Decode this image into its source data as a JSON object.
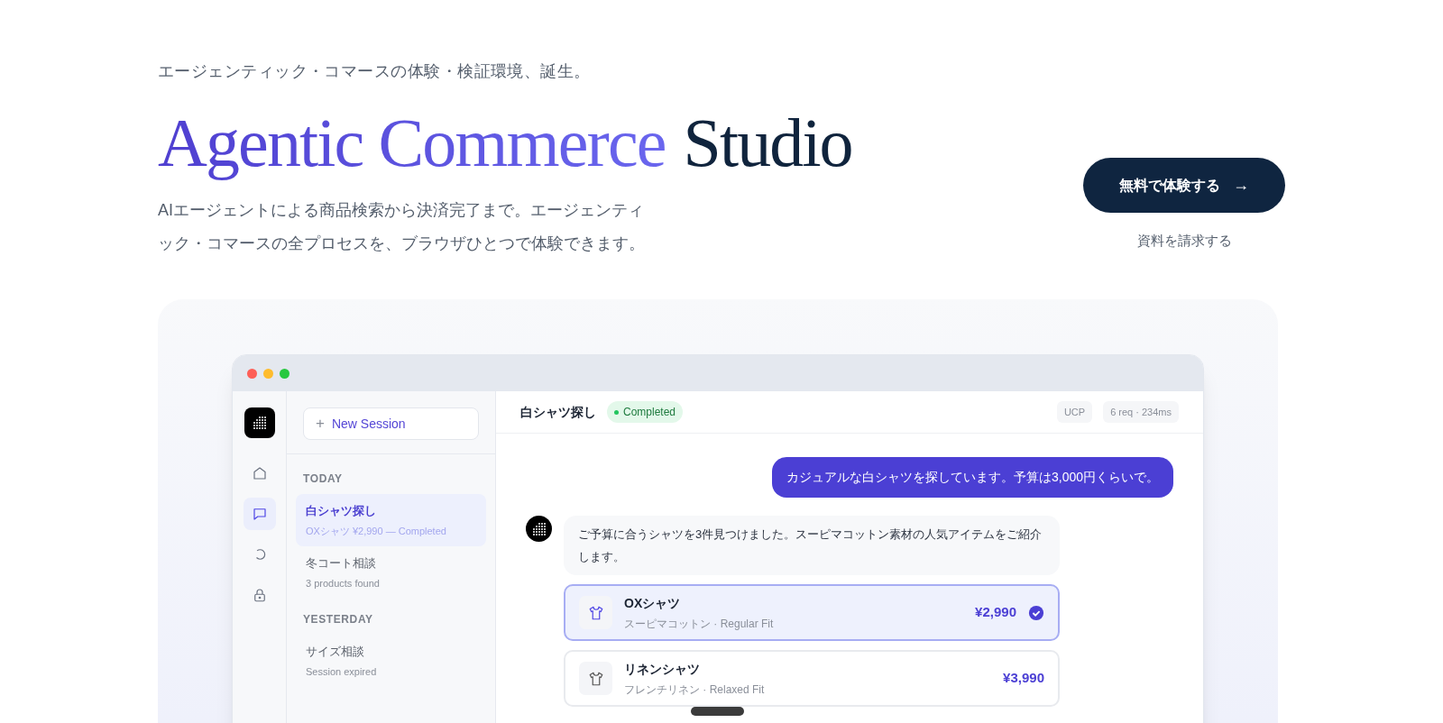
{
  "hero": {
    "tagline": "エージェンティック・コマースの体験・検証環境、誕生。",
    "title": [
      {
        "text": "Agentic Commerce",
        "accent": true
      },
      {
        "text": "Studio",
        "accent": false
      }
    ],
    "description": "AIエージェントによる商品検索から決済完了まで。エージェンティック・コマースの全プロセスを、ブラウザひとつで体験できます。",
    "primary_button": {
      "label": "無料で体験する",
      "arrow": "→"
    },
    "secondary_link": "資料を請求する"
  },
  "app": {
    "rail": [
      {
        "kind": "home",
        "selected": false
      },
      {
        "kind": "chat",
        "selected": true
      },
      {
        "kind": "refresh",
        "selected": false
      },
      {
        "kind": "lock",
        "selected": false
      }
    ],
    "new_session": {
      "icon": "+",
      "label": "New Session"
    },
    "session_groups": [
      {
        "label": "TODAY",
        "items": [
          {
            "title": "白シャツ探し",
            "subtitle": "OXシャツ ¥2,990 — Completed",
            "selected": true
          },
          {
            "title": "冬コート相談",
            "subtitle": "3 products found",
            "selected": false
          }
        ]
      },
      {
        "label": "YESTERDAY",
        "items": [
          {
            "title": "サイズ相談",
            "subtitle": "Session expired",
            "selected": false
          }
        ]
      }
    ],
    "header": {
      "title": "白シャツ探し",
      "status": "Completed",
      "tags": [
        "UCP",
        "6 req · 234ms"
      ]
    },
    "messages": [
      {
        "kind": "user",
        "text": "カジュアルな白シャツを探しています。予算は3,000円くらいで。"
      },
      {
        "kind": "agent",
        "text": "ご予算に合うシャツを3件見つけました。スーピマコットン素材の人気アイテムをご紹介します。"
      }
    ],
    "products": [
      {
        "name": "OXシャツ",
        "detail": "スーピマコットン · Regular Fit",
        "price": "¥2,990",
        "selected": true
      },
      {
        "name": "リネンシャツ",
        "detail": "フレンチリネン · Relaxed Fit",
        "price": "¥3,990",
        "selected": false
      }
    ]
  }
}
